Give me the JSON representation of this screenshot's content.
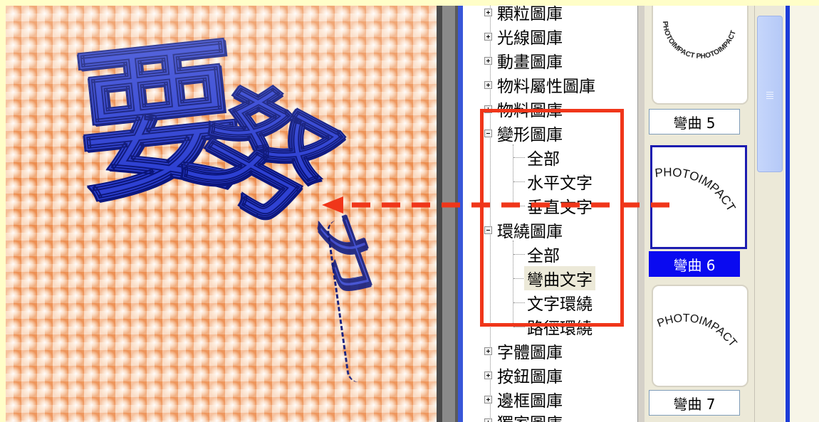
{
  "canvas": {
    "chars": [
      "要",
      "努",
      "力"
    ]
  },
  "tree": {
    "items": [
      {
        "label": "顆粒圖庫",
        "expander": "plus"
      },
      {
        "label": "光線圖庫",
        "expander": "plus"
      },
      {
        "label": "動畫圖庫",
        "expander": "plus"
      },
      {
        "label": "物料屬性圖庫",
        "expander": "plus"
      },
      {
        "label": "物料圖庫",
        "expander": "plus"
      },
      {
        "label": "變形圖庫",
        "expander": "minus",
        "children": [
          "全部",
          "水平文字",
          "垂直文字"
        ]
      },
      {
        "label": "環繞圖庫",
        "expander": "minus",
        "children": [
          "全部",
          "彎曲文字",
          "文字環繞",
          "路徑環繞"
        ],
        "selected_child": "彎曲文字"
      },
      {
        "label": "字體圖庫",
        "expander": "plus"
      },
      {
        "label": "按鈕圖庫",
        "expander": "plus"
      },
      {
        "label": "邊框圖庫",
        "expander": "plus"
      },
      {
        "label": "獨家圖庫",
        "expander": "plus"
      }
    ]
  },
  "thumbnails": [
    {
      "preview_text": "PHOTOIMPACT PHOTOIMPACT",
      "label": "彎曲 5",
      "selected": false
    },
    {
      "preview_text": "PHOTOIMPACT",
      "label": "彎曲 6",
      "selected": true
    },
    {
      "preview_text": "PHOTOIMPACT",
      "label": "彎曲 7",
      "selected": false
    }
  ],
  "colors": {
    "highlight_box": "#f0361a",
    "arrow": "#f0361a",
    "selection": "#0a0af0",
    "text_effect": "#2c3fd2"
  }
}
